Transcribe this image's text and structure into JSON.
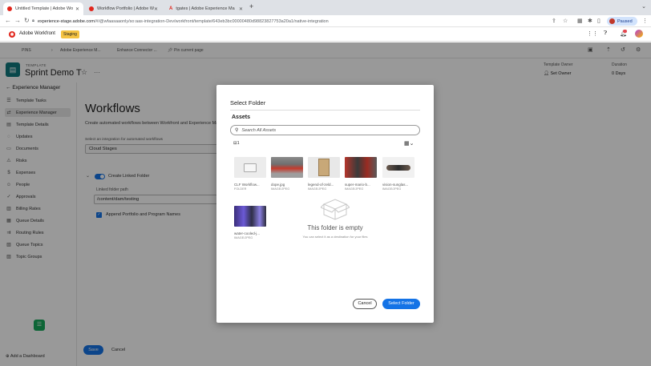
{
  "browser": {
    "tabs": [
      {
        "title": "Untitled Template | Adobe Wo",
        "active": true
      },
      {
        "title": "Workflow Portfolio | Adobe Wo",
        "active": false
      },
      {
        "title": "tgates | Adobe Experience Ma",
        "active": false
      }
    ],
    "new_tab": "+",
    "url_host": "experience-stage.adobe.com",
    "url_path": "/#/@wfaasaaonly/so:aas-integration-Dev/workfront/template/643eb3bc00000480d98823827753a20a1/native-integration",
    "profile_status": "Paused"
  },
  "app": {
    "brand": "Adobe Workfront",
    "env_badge": "Staging"
  },
  "pins": {
    "label": "PINS",
    "items": [
      "Adobe Experience M...",
      "Enhance Connector ...",
      "Pin current page"
    ]
  },
  "template": {
    "kind": "TEMPLATE",
    "name": "Sprint Demo T",
    "owner_label": "Template Owner",
    "owner_value": "Set Owner",
    "duration_label": "Duration",
    "duration_value": "0 Days"
  },
  "sidebar": {
    "header": "Experience Manager",
    "items": [
      {
        "label": "Template Tasks",
        "icon": "tasks-icon"
      },
      {
        "label": "Experience Manager",
        "icon": "experience-manager-icon",
        "active": true
      },
      {
        "label": "Template Details",
        "icon": "details-icon"
      },
      {
        "label": "Updates",
        "icon": "updates-icon"
      },
      {
        "label": "Documents",
        "icon": "documents-icon"
      },
      {
        "label": "Risks",
        "icon": "risks-icon"
      },
      {
        "label": "Expenses",
        "icon": "expenses-icon"
      },
      {
        "label": "People",
        "icon": "people-icon"
      },
      {
        "label": "Approvals",
        "icon": "approvals-icon"
      },
      {
        "label": "Billing Rates",
        "icon": "billing-icon"
      },
      {
        "label": "Queue Details",
        "icon": "queue-icon"
      },
      {
        "label": "Routing Rules",
        "icon": "routing-icon"
      },
      {
        "label": "Queue Topics",
        "icon": "topics-icon"
      },
      {
        "label": "Topic Groups",
        "icon": "groups-icon"
      }
    ],
    "add_dashboard": "Add a Dashboard"
  },
  "workflows": {
    "title": "Workflows",
    "description": "Create automated workflows between Workfront and Experience Ma",
    "integration_label": "Select an integration for automated workflows",
    "integration_value": "Cloud Stages",
    "linked_folder_label": "Create Linked Folder",
    "linked_folder_enabled": true,
    "path_label": "Linked folder path",
    "path_value": "/content/dam/testing",
    "append_label": "Append Portfolio and Program Names",
    "append_checked": true,
    "save": "Save",
    "cancel": "Cancel"
  },
  "modal": {
    "title": "Select Folder",
    "section": "Assets",
    "search_placeholder": "Search All Assets",
    "breadcrumb": "1",
    "assets": [
      {
        "name": "CLF Workflow...",
        "type": "FOLDER",
        "thumb": "folder"
      },
      {
        "name": "dope.jpg",
        "type": "IMAGE/JPEG",
        "thumb": "car"
      },
      {
        "name": "legend-of-zeld...",
        "type": "IMAGE/JPEG",
        "thumb": "book"
      },
      {
        "name": "super-mario-b...",
        "type": "IMAGE/JPEG",
        "thumb": "mario"
      },
      {
        "name": "vision-sunglas...",
        "type": "IMAGE/JPEG",
        "thumb": "sunglasses"
      },
      {
        "name": "water-cooled-j...",
        "type": "IMAGE/JPEG",
        "thumb": "tech"
      }
    ],
    "empty_title": "This folder is empty",
    "empty_sub": "You can select it as a destination for your files",
    "cancel": "Cancel",
    "select": "Select Folder"
  },
  "colors": {
    "primary": "#1473e6",
    "brand_red": "#e1251b",
    "template_teal": "#0f797d",
    "staging": "#f5c342"
  }
}
